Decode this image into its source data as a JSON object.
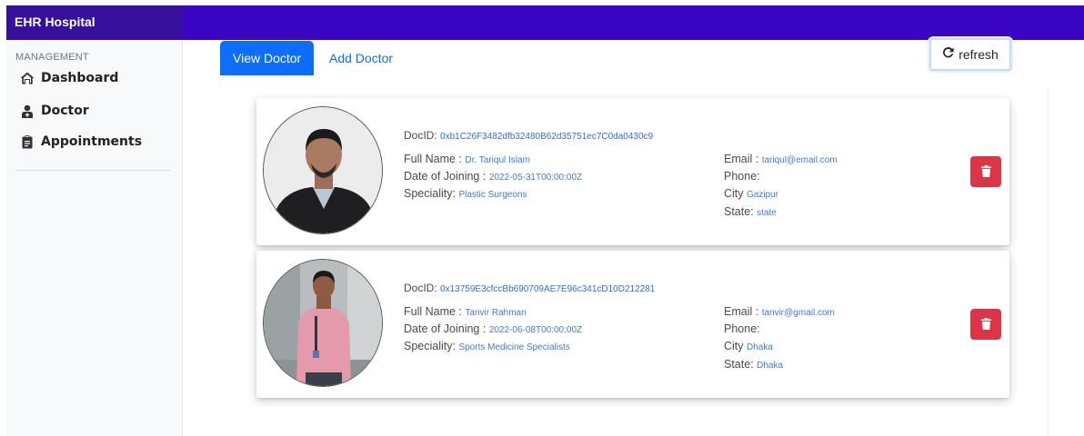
{
  "app": {
    "title": "EHR Hospital"
  },
  "sidebar": {
    "heading": "MANAGEMENT",
    "items": [
      {
        "label": "Dashboard",
        "icon": "home-icon"
      },
      {
        "label": "Doctor",
        "icon": "user-doctor-icon"
      },
      {
        "label": "Appointments",
        "icon": "clipboard-icon"
      }
    ]
  },
  "tabs": [
    {
      "label": "View Doctor",
      "active": true
    },
    {
      "label": "Add Doctor",
      "active": false
    }
  ],
  "refresh": {
    "label": "refresh",
    "icon": "refresh-icon"
  },
  "labels": {
    "docid": "DocID: ",
    "full_name": "Full Name : ",
    "date_joining": "Date of Joining : ",
    "speciality": "Speciality: ",
    "email": "Email : ",
    "phone": "Phone:",
    "city": "City ",
    "state": "State: "
  },
  "doctors": [
    {
      "docid": "0xb1C26F3482dfb32480B62d35751ec7C0da0430c9",
      "full_name": "Dr. Tariqul Islam",
      "date_of_joining": "2022-05-31T00:00:00Z",
      "speciality": "Plastic Surgeons",
      "email": "tariqul@email.com",
      "phone": "",
      "city": "Gazipur",
      "state": "state"
    },
    {
      "docid": "0x13759E3cfccBb690709AE7E96c341cD10D212281",
      "full_name": "Tanvir Rahman",
      "date_of_joining": "2022-06-08T00:00:00Z",
      "speciality": "Sports Medicine Specialists",
      "email": "tanvir@gmail.com",
      "phone": "",
      "city": "Dhaka",
      "state": "Dhaka"
    }
  ],
  "colors": {
    "topbar": "#3a05c2",
    "brand_bar": "#34109c",
    "primary": "#0d6efd",
    "danger": "#dc3545",
    "value_text": "#3e7ae0"
  }
}
